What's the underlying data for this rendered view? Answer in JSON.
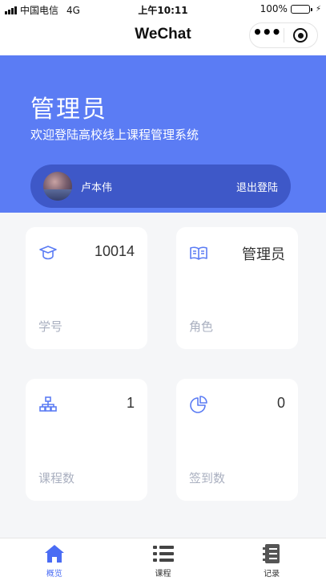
{
  "status_bar": {
    "carrier": "中国电信",
    "network": "4G",
    "time": "上午10:11",
    "battery": "100%"
  },
  "nav": {
    "title": "WeChat"
  },
  "header": {
    "role_title": "管理员",
    "subtitle": "欢迎登陆高校线上课程管理系统",
    "user_name": "卢本伟",
    "logout_label": "退出登陆"
  },
  "stats": [
    {
      "icon": "graduation-cap-icon",
      "value": "10014",
      "label": "学号"
    },
    {
      "icon": "open-book-icon",
      "value": "管理员",
      "label": "角色"
    },
    {
      "icon": "org-chart-icon",
      "value": "1",
      "label": "课程数"
    },
    {
      "icon": "pie-chart-icon",
      "value": "0",
      "label": "签到数"
    }
  ],
  "tabs": [
    {
      "icon": "home-icon",
      "label": "概览",
      "active": true
    },
    {
      "icon": "list-icon",
      "label": "课程",
      "active": false
    },
    {
      "icon": "notebook-icon",
      "label": "记录",
      "active": false
    }
  ],
  "colors": {
    "primary": "#5b7cf4",
    "pill": "#3e58c8",
    "active_tab": "#4a6cf4",
    "label_gray": "#aab0c0",
    "battery": "#4cd964"
  }
}
